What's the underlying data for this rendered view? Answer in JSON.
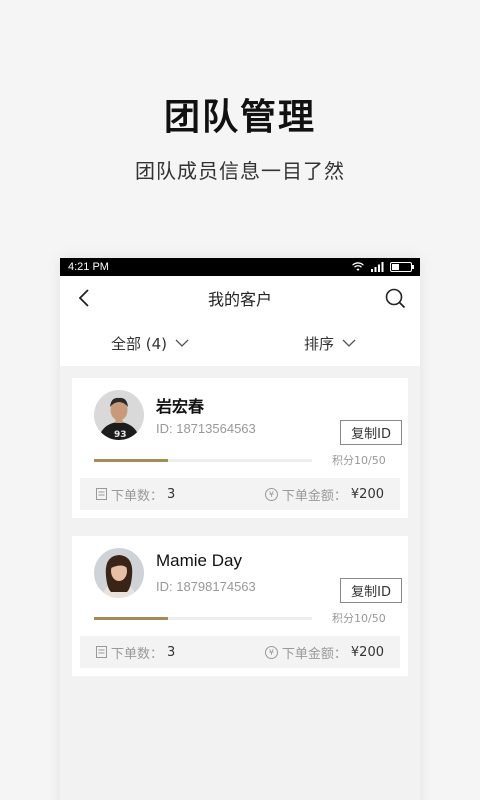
{
  "promo": {
    "title": "团队管理",
    "subtitle": "团队成员信息一目了然"
  },
  "status_bar": {
    "time": "4:21 PM"
  },
  "nav": {
    "title": "我的客户"
  },
  "filters": {
    "all_label": "全部 (4)",
    "sort_label": "排序"
  },
  "customers": [
    {
      "name": "岩宏春",
      "id_text": "ID: 18713564563",
      "copy_label": "复制ID",
      "points_text": "积分10/50",
      "progress": 0.2,
      "orders_label": "下单数：",
      "orders_value": "3",
      "amount_label": "下单金额：",
      "amount_value": "¥200"
    },
    {
      "name": "Mamie Day",
      "id_text": "ID: 18798174563",
      "copy_label": "复制ID",
      "points_text": "积分10/50",
      "progress": 0.2,
      "orders_label": "下单数：",
      "orders_value": "3",
      "amount_label": "下单金额：",
      "amount_value": "¥200"
    }
  ],
  "colors": {
    "accent": "#a88a59",
    "background": "#f5f5f5"
  },
  "icons": [
    "back-icon",
    "search-icon",
    "chevron-down-icon",
    "document-icon",
    "yen-icon",
    "wifi-icon",
    "signal-icon",
    "battery-icon"
  ]
}
